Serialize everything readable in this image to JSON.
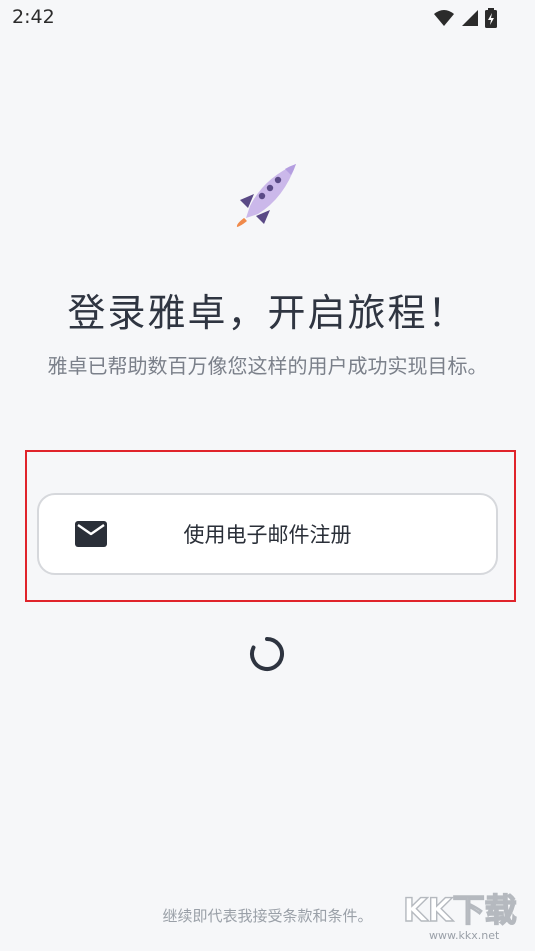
{
  "status_bar": {
    "time": "2:42",
    "icons": [
      "wifi-icon",
      "signal-icon",
      "battery-icon"
    ]
  },
  "hero": {
    "icon": "rocket-icon",
    "title": "登录雅卓，开启旅程！",
    "subtitle": "雅卓已帮助数百万像您这样的用户成功实现目标。"
  },
  "actions": {
    "email_signup_label": "使用电子邮件注册",
    "email_icon": "mail-icon"
  },
  "loading": {
    "icon": "spinner-icon"
  },
  "footer": {
    "terms_text": "继续即代表我接受条款和条件。"
  },
  "watermark": {
    "brand": "KK下载",
    "url": "www.kkx.net"
  },
  "colors": {
    "background": "#f6f7f9",
    "highlight": "#e0242b",
    "rocket_body": "#cbb8ea",
    "rocket_window": "#5a4a86",
    "flame": "#f08a4b"
  }
}
